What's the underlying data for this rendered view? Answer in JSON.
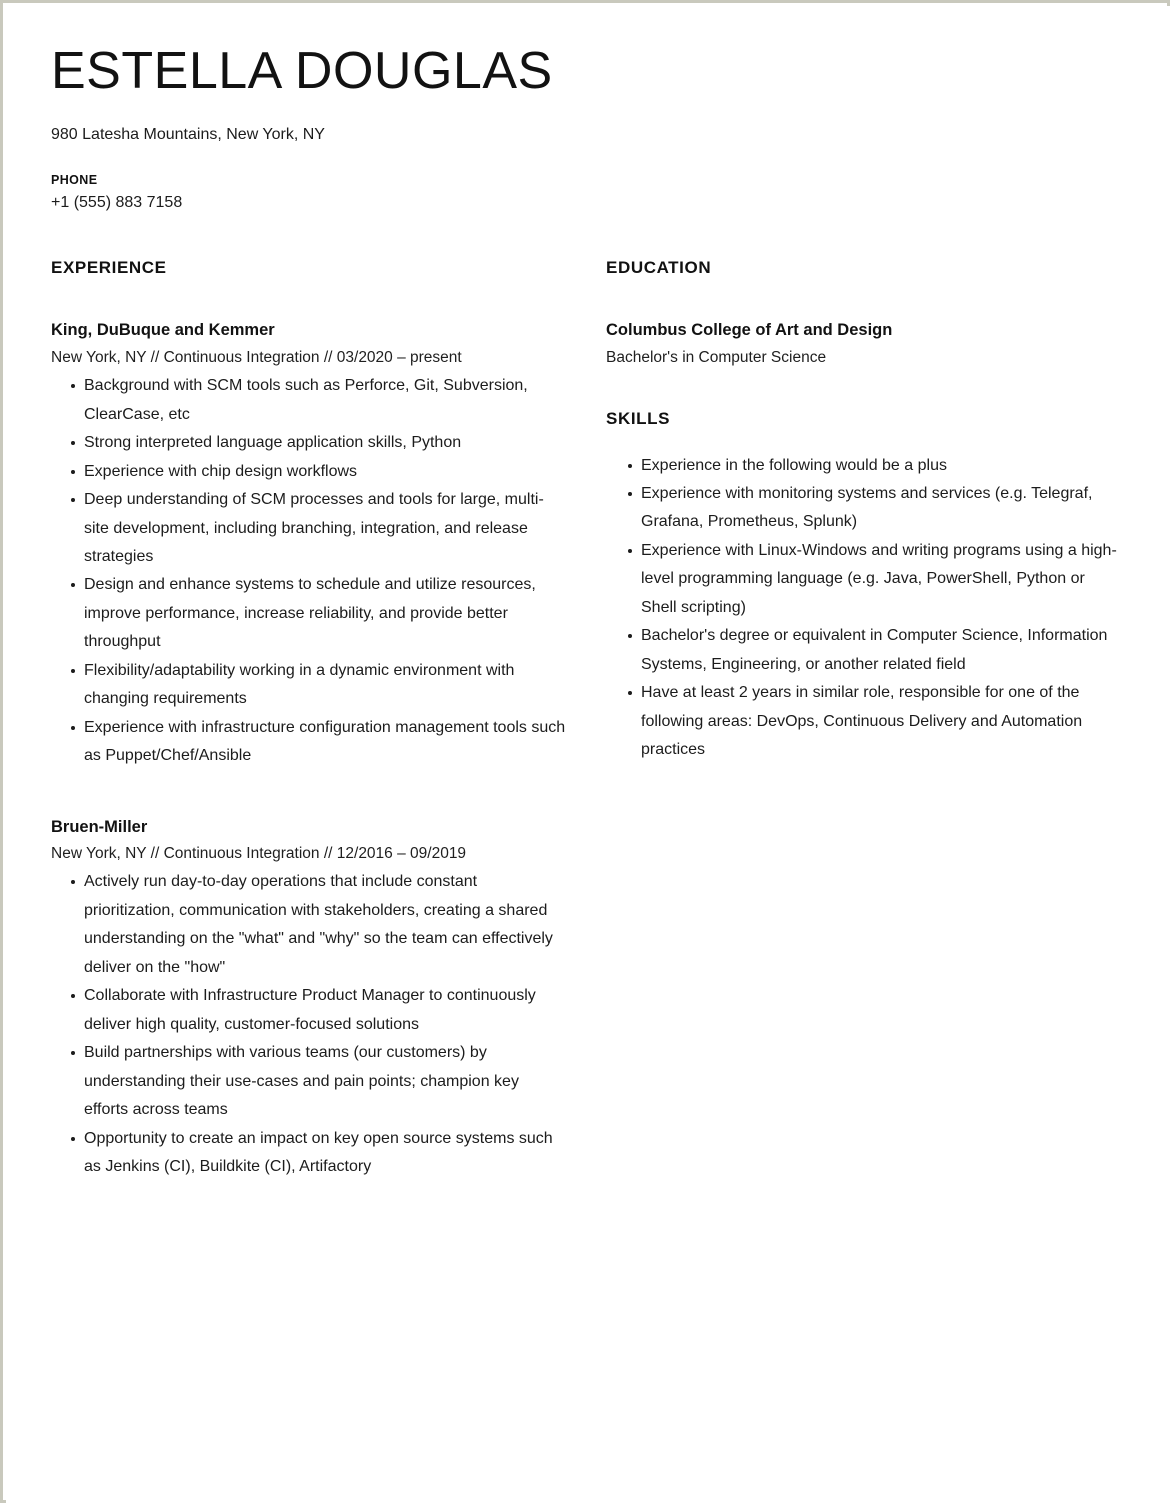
{
  "header": {
    "full_name": "ESTELLA DOUGLAS",
    "address": "980 Latesha Mountains, New York, NY",
    "phone_label": "PHONE",
    "phone_value": "+1 (555) 883 7158"
  },
  "experience": {
    "section_title": "EXPERIENCE",
    "jobs": [
      {
        "organization": "King, DuBuque and Kemmer",
        "meta": "New York, NY // Continuous Integration // 03/2020 – present",
        "bullets": [
          "Background with SCM tools such as Perforce, Git, Subversion, ClearCase, etc",
          "Strong interpreted language application skills, Python",
          "Experience with chip design workflows",
          "Deep understanding of SCM processes and tools for large, multi-site development, including branching, integration, and release strategies",
          "Design and enhance systems to schedule and utilize resources, improve performance, increase reliability, and provide better throughput",
          "Flexibility/adaptability working in a dynamic environment with changing requirements",
          "Experience with infrastructure configuration management tools such as Puppet/Chef/Ansible"
        ]
      },
      {
        "organization": "Bruen-Miller",
        "meta": "New York, NY // Continuous Integration // 12/2016 – 09/2019",
        "bullets": [
          "Actively run day-to-day operations that include constant prioritization, communication with stakeholders, creating a shared understanding on the \"what\" and \"why\" so the team can effectively deliver on the \"how\"",
          "Collaborate with Infrastructure Product Manager to continuously deliver high quality, customer-focused solutions",
          "Build partnerships with various teams (our customers) by understanding their use-cases and pain points; champion key efforts across teams",
          "Opportunity to create an impact on key open source systems such as Jenkins (CI), Buildkite (CI), Artifactory"
        ]
      }
    ]
  },
  "education": {
    "section_title": "EDUCATION",
    "school": "Columbus College of Art and Design",
    "degree": "Bachelor's in Computer Science"
  },
  "skills": {
    "section_title": "SKILLS",
    "items": [
      "Experience in the following would be a plus",
      "Experience with monitoring systems and services (e.g. Telegraf, Grafana, Prometheus, Splunk)",
      "Experience with Linux-Windows and writing programs using a high-level programming language (e.g. Java, PowerShell, Python or Shell scripting)",
      "Bachelor's degree or equivalent in Computer Science, Information Systems, Engineering, or another related field",
      "Have at least 2 years in similar role, responsible for one of the following areas: DevOps, Continuous Delivery and Automation practices"
    ]
  },
  "colors": {
    "page_background": "#ffffff",
    "page_border": "#c9c9bd",
    "text_primary": "#1c1c1c",
    "heading": "#111111"
  }
}
